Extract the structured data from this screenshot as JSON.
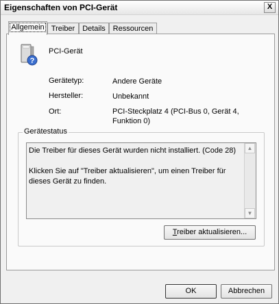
{
  "window": {
    "title": "Eigenschaften von PCI-Gerät",
    "close_glyph": "X"
  },
  "tabs": [
    {
      "label": "Allgemein",
      "active": true
    },
    {
      "label": "Treiber",
      "active": false
    },
    {
      "label": "Details",
      "active": false
    },
    {
      "label": "Ressourcen",
      "active": false
    }
  ],
  "device": {
    "name": "PCI-Gerät",
    "icon": "unknown-device-icon",
    "properties": [
      {
        "label": "Gerätetyp:",
        "value": "Andere Geräte"
      },
      {
        "label": "Hersteller:",
        "value": "Unbekannt"
      },
      {
        "label": "Ort:",
        "value": "PCI-Steckplatz 4 (PCI-Bus 0, Gerät 4, Funktion 0)"
      }
    ]
  },
  "status": {
    "title": "Gerätestatus",
    "line1": "Die Treiber für dieses Gerät wurden nicht installiert. (Code 28)",
    "line2": "Klicken Sie auf \"Treiber aktualisieren\", um einen Treiber für dieses Gerät zu finden.",
    "update_button": {
      "mnemonic": "T",
      "rest": "reiber aktualisieren..."
    }
  },
  "footer": {
    "ok": "OK",
    "cancel": "Abbrechen"
  }
}
